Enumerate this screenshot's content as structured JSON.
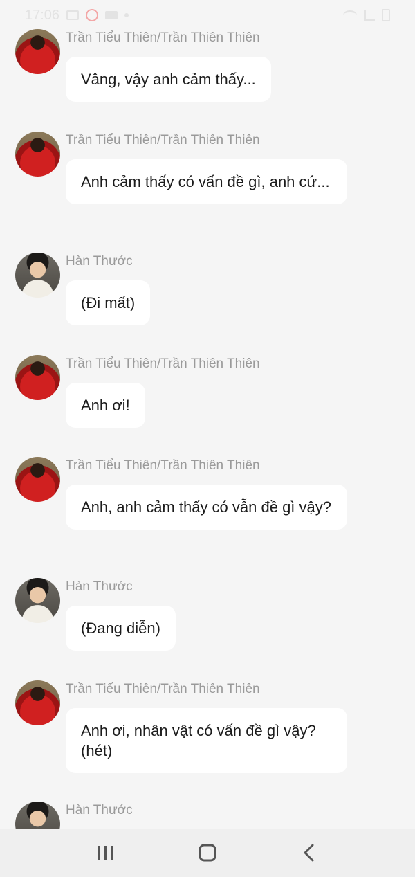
{
  "status_bar": {
    "time": "17:06"
  },
  "messages": [
    {
      "sender": "Trần Tiểu Thiên/Trần Thiên Thiên",
      "avatar": "red",
      "text": "Vâng, vậy anh cảm thấy..."
    },
    {
      "sender": "Trần Tiểu Thiên/Trần Thiên Thiên",
      "avatar": "red",
      "text": "Anh cảm thấy có vấn đề gì, anh cứ..."
    },
    {
      "sender": "Hàn Thước",
      "avatar": "man",
      "text": "(Đi mất)"
    },
    {
      "sender": "Trần Tiểu Thiên/Trần Thiên Thiên",
      "avatar": "red",
      "text": "Anh ơi!"
    },
    {
      "sender": "Trần Tiểu Thiên/Trần Thiên Thiên",
      "avatar": "red",
      "text": "Anh, anh cảm thấy có vẫn đề gì vậy?"
    },
    {
      "sender": "Hàn Thước",
      "avatar": "man",
      "text": "(Đang diễn)"
    },
    {
      "sender": "Trần Tiểu Thiên/Trần Thiên Thiên",
      "avatar": "red",
      "text": "Anh ơi, nhân vật có vấn đề gì vậy? (hét)"
    },
    {
      "sender": "Hàn Thước",
      "avatar": "man",
      "text": ""
    }
  ],
  "nav_bar": {
    "icons": [
      "recents-icon",
      "home-icon",
      "back-icon"
    ]
  }
}
